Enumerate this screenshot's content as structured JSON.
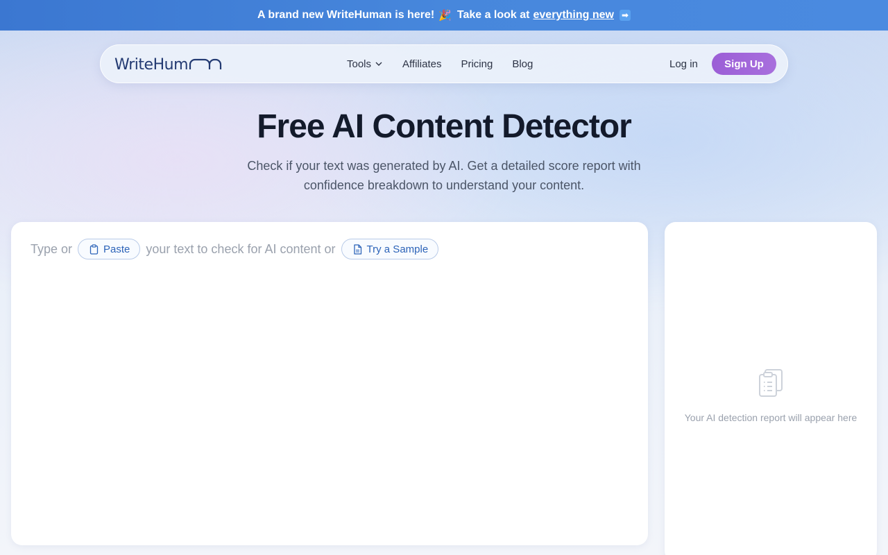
{
  "banner": {
    "text": "A brand new WriteHuman is here!",
    "emoji": "🎉",
    "cta_prefix": "Take a look at",
    "cta_link": "everything new",
    "arrow": "➡"
  },
  "nav": {
    "logo": "WriteHum",
    "links": [
      "Tools",
      "Affiliates",
      "Pricing",
      "Blog"
    ],
    "login": "Log in",
    "signup": "Sign Up"
  },
  "hero": {
    "title": "Free AI Content Detector",
    "subtitle": "Check if your text was generated by AI. Get a detailed score report with confidence breakdown to understand your content."
  },
  "editor": {
    "prefix": "Type or",
    "paste_label": "Paste",
    "middle": "your text to check for AI content or",
    "sample_label": "Try a Sample"
  },
  "report": {
    "icon": "clipboard-list-icon",
    "placeholder": "Your AI detection report will appear here"
  },
  "colors": {
    "banner": "#3b77d1",
    "signup": "#9b5ed6",
    "chip_text": "#2c63b8",
    "logo": "#233a72"
  }
}
